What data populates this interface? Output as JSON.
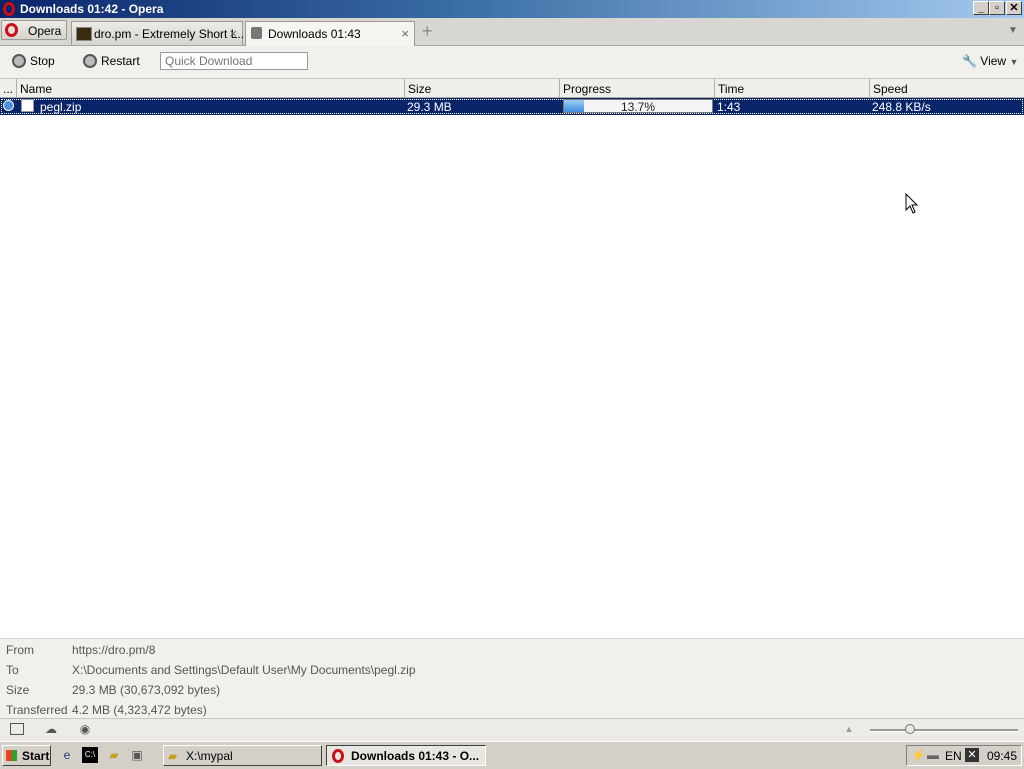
{
  "window": {
    "title": "Downloads 01:42 - Opera",
    "controls": [
      "minimize",
      "maximize",
      "close"
    ]
  },
  "tabs": {
    "menu_label": "Opera",
    "items": [
      {
        "label": "dro.pm - Extremely Short L...",
        "close": "×"
      },
      {
        "label": "Downloads 01:43",
        "close": "×"
      }
    ],
    "new_tab": "+"
  },
  "toolbar": {
    "stop_label": "Stop",
    "restart_label": "Restart",
    "quick_download_placeholder": "Quick Download",
    "view_label": "View"
  },
  "columns": {
    "menu": "...",
    "name": "Name",
    "size": "Size",
    "progress": "Progress",
    "time": "Time",
    "speed": "Speed"
  },
  "downloads": [
    {
      "name": "pegl.zip",
      "size": "29.3 MB",
      "progress_text": "13.7%",
      "progress_fraction": 0.137,
      "time": "1:43",
      "speed": "248.8 KB/s"
    }
  ],
  "details": {
    "from_label": "From",
    "from_value": "https://dro.pm/8",
    "to_label": "To",
    "to_value": "X:\\Documents and Settings\\Default User\\My Documents\\pegl.zip",
    "size_label": "Size",
    "size_value": "29.3 MB (30,673,092 bytes)",
    "transferred_label": "Transferred",
    "transferred_value": "4.2 MB (4,323,472 bytes)"
  },
  "statusbar": {
    "zoom_fraction": 0.27
  },
  "taskbar": {
    "start_label": "Start",
    "tasks": [
      {
        "label": "X:\\mypal"
      },
      {
        "label": "Downloads 01:43 - O..."
      }
    ],
    "language": "EN",
    "clock": "09:45"
  },
  "colors": {
    "selection": "#0a246a",
    "opera_red": "#cc0f16",
    "progress_fill": "#3d8ede"
  }
}
